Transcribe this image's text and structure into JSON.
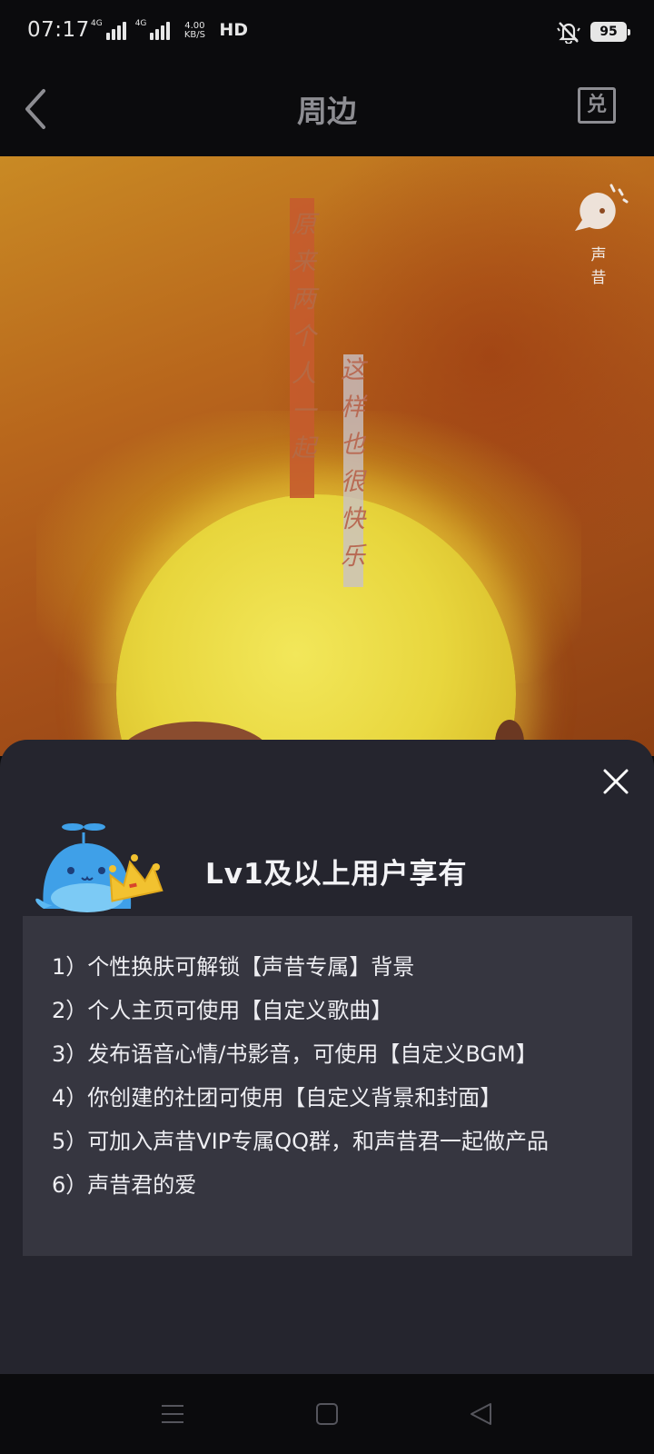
{
  "status_bar": {
    "time": "07:17",
    "network1": "4G",
    "network2": "4G",
    "speed_value": "4.00",
    "speed_unit": "KB/S",
    "hd": "HD",
    "battery": "95"
  },
  "nav": {
    "title": "周边",
    "exchange_label": "兑"
  },
  "banner": {
    "vertical_text_1": "原来两个人一起",
    "vertical_text_2": "这样也很快乐",
    "logo_text": "声 昔"
  },
  "sheet": {
    "title": "Lv1及以上用户享有",
    "benefits": [
      "1）个性换肤可解锁【声昔专属】背景",
      "2）个人主页可使用【自定义歌曲】",
      "3）发布语音心情/书影音，可使用【自定义BGM】",
      "4）你创建的社团可使用【自定义背景和封面】",
      "5）可加入声昔VIP专属QQ群，和声昔君一起做产品",
      "6）声昔君的爱"
    ]
  },
  "colors": {
    "sheet_bg": "#25252e",
    "benefits_bg": "#363640",
    "banner_orange": "#b8661c",
    "moon_yellow": "#e8d63d"
  }
}
